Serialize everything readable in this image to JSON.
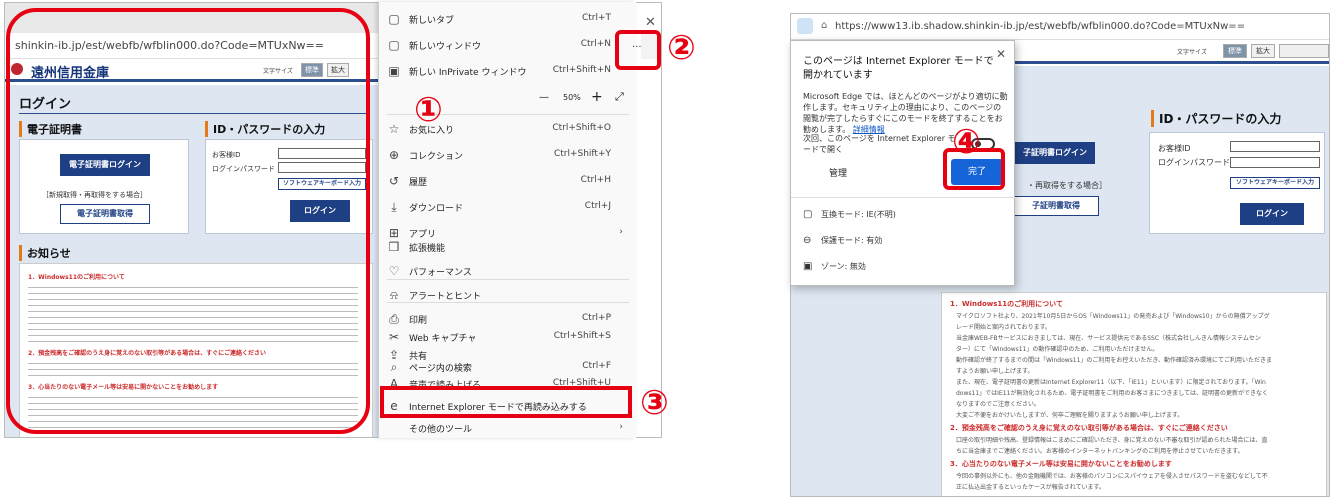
{
  "left": {
    "url": "shinkin-ib.jp/est/webfb/wfblin000.do?Code=MTUxNw==",
    "brand": "遠州信用金庫",
    "fontsize_label": "文字サイズ",
    "btn_standard": "標準",
    "btn_large": "拡大",
    "login_title": "ログイン",
    "cert_heading": "電子証明書",
    "cert_login_button": "電子証明書ログイン",
    "cert_note": "［新規取得・再取得をする場合］",
    "cert_get_button": "電子証明書取得",
    "idpw_heading": "ID・パスワードの入力",
    "customer_id_label": "お客様ID",
    "login_pw_label": "ログインパスワード",
    "softkey_button": "ソフトウェアキーボード入力",
    "login_button": "ログイン",
    "news_heading": "お知らせ",
    "news_title_1": "1．Windows11のご利用について",
    "news_title_2": "2．預金残高をご確認のうえ身に覚えのない取引等がある場合は、すぐにご連絡ください",
    "news_title_3": "3．心当たりのない電子メール等は安易に開かないことをお勧めします"
  },
  "menu": {
    "more_button": "···",
    "zoom_minus": "—",
    "zoom_value": "50%",
    "zoom_plus": "+",
    "zoom_expand": "⤢",
    "items": [
      {
        "icon": "▢",
        "label": "新しいタブ",
        "shortcut": "Ctrl+T"
      },
      {
        "icon": "▢",
        "label": "新しいウィンドウ",
        "shortcut": "Ctrl+N"
      },
      {
        "icon": "▣",
        "label": "新しい InPrivate ウィンドウ",
        "shortcut": "Ctrl+Shift+N"
      },
      {
        "icon": "☆",
        "label": "お気に入り",
        "shortcut": "Ctrl+Shift+O"
      },
      {
        "icon": "⊕",
        "label": "コレクション",
        "shortcut": "Ctrl+Shift+Y"
      },
      {
        "icon": "↺",
        "label": "履歴",
        "shortcut": "Ctrl+H"
      },
      {
        "icon": "⤓",
        "label": "ダウンロード",
        "shortcut": "Ctrl+J"
      },
      {
        "icon": "⊞",
        "label": "アプリ",
        "shortcut": "›"
      },
      {
        "icon": "❒",
        "label": "拡張機能",
        "shortcut": ""
      },
      {
        "icon": "♡",
        "label": "パフォーマンス",
        "shortcut": ""
      },
      {
        "icon": "⍾",
        "label": "アラートとヒント",
        "shortcut": ""
      },
      {
        "icon": "⎙",
        "label": "印刷",
        "shortcut": "Ctrl+P"
      },
      {
        "icon": "✂",
        "label": "Web キャプチャ",
        "shortcut": "Ctrl+Shift+S"
      },
      {
        "icon": "⇪",
        "label": "共有",
        "shortcut": ""
      },
      {
        "icon": "⌕",
        "label": "ページ内の検索",
        "shortcut": "Ctrl+F"
      },
      {
        "icon": "A",
        "label": "音声で読み上げる",
        "shortcut": "Ctrl+Shift+U"
      },
      {
        "icon": "e",
        "label": "Internet Explorer モードで再読み込みする",
        "shortcut": ""
      },
      {
        "icon": "",
        "label": "その他のツール",
        "shortcut": "›"
      }
    ]
  },
  "right": {
    "url": "https://www13.ib.shadow.shinkin-ib.jp/est/webfb/wfblin000.do?Code=MTUxNw==",
    "fontsize_label": "文字サイズ",
    "btn_standard": "標準",
    "btn_large": "拡大",
    "idpw_heading": "ID・パスワードの入力",
    "customer_id_label": "お客様ID",
    "login_pw_label": "ログインパスワード",
    "softkey_button": "ソフトウェアキーボード入力",
    "login_button": "ログイン",
    "cert_login_button": "子証明書ログイン",
    "cert_note": "・再取得をする場合］",
    "cert_get_button": "子証明書取得",
    "news": {
      "title_1": "1．Windows11のご利用について",
      "lines_1": [
        "マイクロソフト社より、2021年10月5日からOS「Windows11」の発売および「Windows10」からの無償アップグ",
        "レード開始と案内されております。",
        "当金庫WEB-FBサービスにおきましては、現在、サービス提供元であるSSC（株式会社しんきん情報システムセン",
        "ター）にて「Windows11」の動作確認中のため、ご利用いただけません。",
        "動作確認が終了するまでの間は「Windows11」のご利用をお控えいただき、動作確認済み環境にてご利用いただきま",
        "すようお願い申し上げます。",
        "また、現在、電子証明書の更新はInternet Explorer11（以下、「IE11」といいます）に限定されております。「Win",
        "dows11」ではIE11が無効化されるため、電子証明書をご利用のお客さまにつきましては、証明書の更新ができなく",
        "なりますのでご注意ください。",
        "大変ご不便をおかけいたしますが、何卒ご理解を賜りますようお願い申し上げます。"
      ],
      "title_2": "2．預金残高をご確認のうえ身に覚えのない取引等がある場合は、すぐにご連絡ください",
      "lines_2": [
        "口座の取引明細や残高、登録情報はこまめにご確認いただき、身に覚えのない不審な取引が認められた場合には、直",
        "ちに当金庫までご連絡ください。お客様のインターネットバンキングのご利用を停止させていただきます。"
      ],
      "title_3": "3．心当たりのない電子メール等は安易に開かないことをお勧めします",
      "lines_3": [
        "今回の事例以外にも、他の金融機関では、お客様のパソコンにスパイウェアを侵入させパスワードを盗むなどして不",
        "正に払込出金するといったケースが報告されています。"
      ]
    }
  },
  "popup": {
    "title": "このページは Internet Explorer モードで開かれています",
    "body": "Microsoft Edge では、ほとんどのページがより適切に動作します。セキュリティ上の理由により、このページの閲覧が完了したらすぐにこのモードを終了することをお勧めします。",
    "detail_link": "詳細情報",
    "toggle_label": "次回、このページを Internet Explorer モードで開く",
    "manage_button": "管理",
    "done_button": "完了",
    "row_compat": "互換モード: IE(不明)",
    "row_protect": "保護モード: 有効",
    "row_zone": "ゾーン: 無効"
  },
  "markers": {
    "n1": "①",
    "n2": "②",
    "n3": "③",
    "n4": "④"
  }
}
